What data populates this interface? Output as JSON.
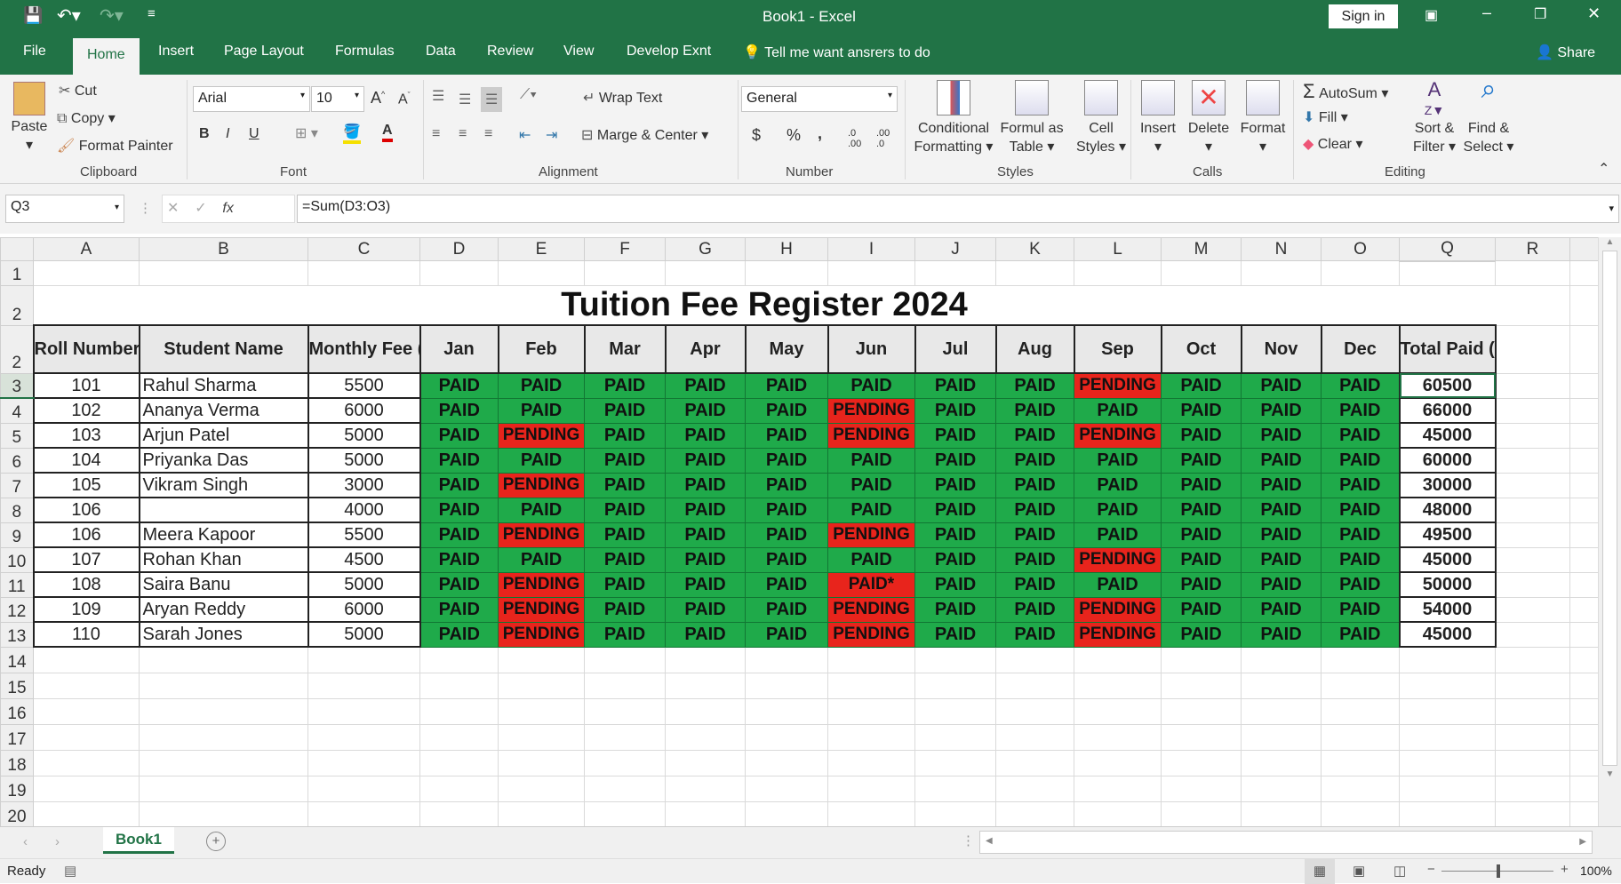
{
  "app": {
    "title": "Book1  -  Excel",
    "sign_in": "Sign in",
    "share": "Share"
  },
  "tabs": [
    "File",
    "Home",
    "Insert",
    "Page Layout",
    "Formulas",
    "Data",
    "Review",
    "View",
    "Develop Exnt"
  ],
  "tell_me": "Tell me want ansrers to do",
  "ribbon": {
    "clipboard": {
      "paste": "Paste",
      "cut": "Cut",
      "copy": "Copy",
      "format_painter": "Format Painter",
      "label": "Clipboard"
    },
    "font": {
      "name": "Arial",
      "size": "10",
      "label": "Font",
      "bold": "B",
      "italic": "I",
      "underline": "U"
    },
    "alignment": {
      "wrap": "Wrap Text",
      "merge": "Marge & Center",
      "label": "Alignment"
    },
    "number": {
      "format": "General",
      "currency": "$",
      "percent": "%",
      "comma": ",",
      "label": "Number"
    },
    "styles": {
      "cond1": "Conditional",
      "cond2": "Formatting",
      "fmt1": "Formul as",
      "fmt2": "Table",
      "cell1": "Cell",
      "cell2": "Styles",
      "label": "Styles"
    },
    "cells": {
      "insert": "Insert",
      "delete": "Delete",
      "format": "Format",
      "label": "Calls"
    },
    "editing": {
      "autosum": "AutoSum",
      "fill": "Fill",
      "clear": "Clear",
      "sort1": "Sort &",
      "sort2": "Filter",
      "find1": "Find &",
      "find2": "Select",
      "label": "Editing"
    }
  },
  "name_box": "Q3",
  "formula": "=Sum(D3:O3)",
  "columns": [
    "A",
    "B",
    "C",
    "D",
    "E",
    "F",
    "G",
    "H",
    "I",
    "J",
    "K",
    "L",
    "M",
    "N",
    "O",
    "Q",
    "R"
  ],
  "row_headers": [
    "1",
    "2",
    "2",
    "3",
    "4",
    "5",
    "6",
    "7",
    "8",
    "9",
    "10",
    "11",
    "12",
    "13",
    "14",
    "15",
    "16",
    "17",
    "18",
    "19",
    "20"
  ],
  "sheet": {
    "title": "Tuition Fee Register 2024",
    "headers": [
      "Roll Number",
      "Student Name",
      "Monthly Fee (INR)",
      "Jan",
      "Feb",
      "Mar",
      "Apr",
      "May",
      "Jun",
      "Jul",
      "Aug",
      "Sep",
      "Oct",
      "Nov",
      "Dec",
      "Total Paid (INR)"
    ],
    "rows": [
      {
        "roll": "101",
        "name": "Rahul Sharma",
        "fee": "5500",
        "months": [
          "PAID",
          "PAID",
          "PAID",
          "PAID",
          "PAID",
          "PAID",
          "PAID",
          "PAID",
          "PENDING",
          "PAID",
          "PAID",
          "PAID"
        ],
        "total": "60500"
      },
      {
        "roll": "102",
        "name": "Ananya Verma",
        "fee": "6000",
        "months": [
          "PAID",
          "PAID",
          "PAID",
          "PAID",
          "PAID",
          "PENDING",
          "PAID",
          "PAID",
          "PAID",
          "PAID",
          "PAID",
          "PAID"
        ],
        "total": "66000"
      },
      {
        "roll": "103",
        "name": "Arjun Patel",
        "fee": "5000",
        "months": [
          "PAID",
          "PENDING",
          "PAID",
          "PAID",
          "PAID",
          "PENDING",
          "PAID",
          "PAID",
          "PENDING",
          "PAID",
          "PAID",
          "PAID"
        ],
        "total": "45000"
      },
      {
        "roll": "104",
        "name": "Priyanka Das",
        "fee": "5000",
        "months": [
          "PAID",
          "PAID",
          "PAID",
          "PAID",
          "PAID",
          "PAID",
          "PAID",
          "PAID",
          "PAID",
          "PAID",
          "PAID",
          "PAID"
        ],
        "total": "60000"
      },
      {
        "roll": "105",
        "name": "Vikram Singh",
        "fee": "3000",
        "months": [
          "PAID",
          "PENDING",
          "PAID",
          "PAID",
          "PAID",
          "PAID",
          "PAID",
          "PAID",
          "PAID",
          "PAID",
          "PAID",
          "PAID"
        ],
        "total": "30000"
      },
      {
        "roll": "106",
        "name": "",
        "fee": "4000",
        "months": [
          "PAID",
          "PAID",
          "PAID",
          "PAID",
          "PAID",
          "PAID",
          "PAID",
          "PAID",
          "PAID",
          "PAID",
          "PAID",
          "PAID"
        ],
        "total": "48000"
      },
      {
        "roll": "106",
        "name": "Meera Kapoor",
        "fee": "5500",
        "months": [
          "PAID",
          "PENDING",
          "PAID",
          "PAID",
          "PAID",
          "PENDING",
          "PAID",
          "PAID",
          "PAID",
          "PAID",
          "PAID",
          "PAID"
        ],
        "total": "49500"
      },
      {
        "roll": "107",
        "name": "Rohan Khan",
        "fee": "4500",
        "months": [
          "PAID",
          "PAID",
          "PAID",
          "PAID",
          "PAID",
          "PAID",
          "PAID",
          "PAID",
          "PENDING",
          "PAID",
          "PAID",
          "PAID"
        ],
        "total": "45000"
      },
      {
        "roll": "108",
        "name": "Saira Banu",
        "fee": "5000",
        "months": [
          "PAID",
          "PENDING",
          "PAID",
          "PAID",
          "PAID",
          "PAID*",
          "PAID",
          "PAID",
          "PAID",
          "PAID",
          "PAID",
          "PAID"
        ],
        "total": "50000"
      },
      {
        "roll": "109",
        "name": "Aryan Reddy",
        "fee": "6000",
        "months": [
          "PAID",
          "PENDING",
          "PAID",
          "PAID",
          "PAID",
          "PENDING",
          "PAID",
          "PAID",
          "PENDING",
          "PAID",
          "PAID",
          "PAID"
        ],
        "total": "54000"
      },
      {
        "roll": "110",
        "name": "Sarah Jones",
        "fee": "5000",
        "months": [
          "PAID",
          "PENDING",
          "PAID",
          "PAID",
          "PAID",
          "PENDING",
          "PAID",
          "PAID",
          "PENDING",
          "PAID",
          "PAID",
          "PAID"
        ],
        "total": "45000"
      }
    ]
  },
  "sheet_tab": "Book1",
  "status": {
    "ready": "Ready",
    "zoom": "100%"
  },
  "colors": {
    "brand": "#217346",
    "paid": "#1faa4a",
    "pending": "#e8241c"
  }
}
